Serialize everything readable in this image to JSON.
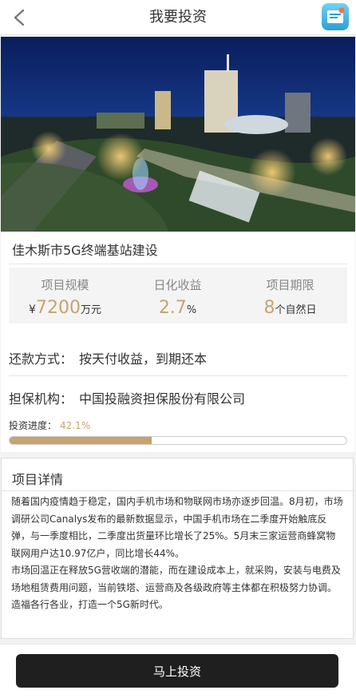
{
  "header": {
    "title": "我要投资"
  },
  "project": {
    "name": "佳木斯市5G终端基站建设",
    "stats": [
      {
        "label": "项目规模",
        "prefix": "¥",
        "value": "7200",
        "unit": "万元"
      },
      {
        "label": "日化收益",
        "prefix": "",
        "value": "2.7",
        "unit": "%"
      },
      {
        "label": "项目期限",
        "prefix": "",
        "value": "8",
        "unit": "个自然日"
      }
    ],
    "repayment_label": "还款方式：",
    "repayment_value": "按天付收益，到期还本",
    "guarantor_label": "担保机构：",
    "guarantor_value": "中国投融资担保股份有限公司",
    "progress_label": "投资进度：",
    "progress_text": "42.1%",
    "progress_fraction": 0.421
  },
  "detail": {
    "title": "项目详情",
    "paragraphs": [
      "随着国内疫情趋于稳定，国内手机市场和物联网市场亦逐步回温。8月初，市场调研公司Canalys发布的最新数据显示，中国手机市场在二季度开始触底反弹，与一季度相比，二季度出货量环比增长了25%。5月末三家运营商蜂窝物联网用户达10.97亿户，同比增长44%。",
      "市场回温正在释放5G营收端的潜能，而在建设成本上，就采购，安装与电费及场地租赁费用问题，当前铁塔、运营商及各级政府等主体都在积极努力协调。造福各行各业，打造一个5G新时代。"
    ]
  },
  "footer": {
    "invest_label": "马上投资"
  },
  "colors": {
    "accent": "#c7a36e",
    "button_bg": "#1f1f1f"
  },
  "icons": {
    "back": "chevron-left-icon",
    "menu": "app-menu-icon"
  }
}
